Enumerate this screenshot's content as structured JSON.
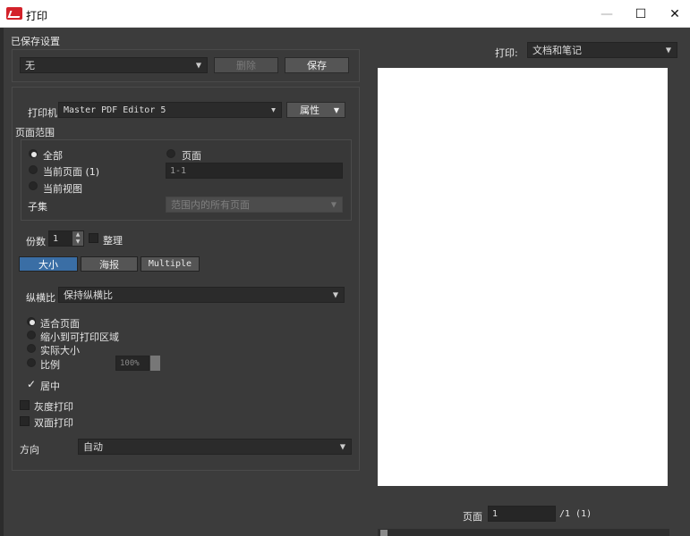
{
  "window": {
    "title": "打印",
    "min": "—",
    "max": "☐",
    "close": "✕"
  },
  "saved": {
    "heading": "已保存设置",
    "value": "无",
    "delete_label": "删除",
    "save_label": "保存"
  },
  "printer": {
    "label": "打印机",
    "value": "Master PDF Editor 5",
    "props_label": "属性"
  },
  "page_range": {
    "heading": "页面范围",
    "all_label": "全部",
    "current_label": "当前页面 (1)",
    "view_label": "当前视图",
    "pages_label": "页面",
    "pages_value": "1-1",
    "subset_label": "子集",
    "subset_value": "范围内的所有页面"
  },
  "copies": {
    "label": "份数",
    "value": "1",
    "collate_label": "整理"
  },
  "tabs": [
    "大小",
    "海报",
    "Multiple"
  ],
  "aspect": {
    "label": "纵横比",
    "value": "保持纵横比"
  },
  "scale": {
    "fit_label": "适合页面",
    "shrink_label": "缩小到可打印区域",
    "actual_label": "实际大小",
    "ratio_label": "比例",
    "ratio_value": "100%",
    "center_label": "居中"
  },
  "options": {
    "grayscale_label": "灰度打印",
    "duplex_label": "双面打印"
  },
  "orientation": {
    "label": "方向",
    "value": "自动"
  },
  "preview": {
    "print_label": "打印:",
    "print_value": "文档和笔记",
    "page_label": "页面",
    "page_value": "1",
    "page_total": "/1 (1)"
  }
}
